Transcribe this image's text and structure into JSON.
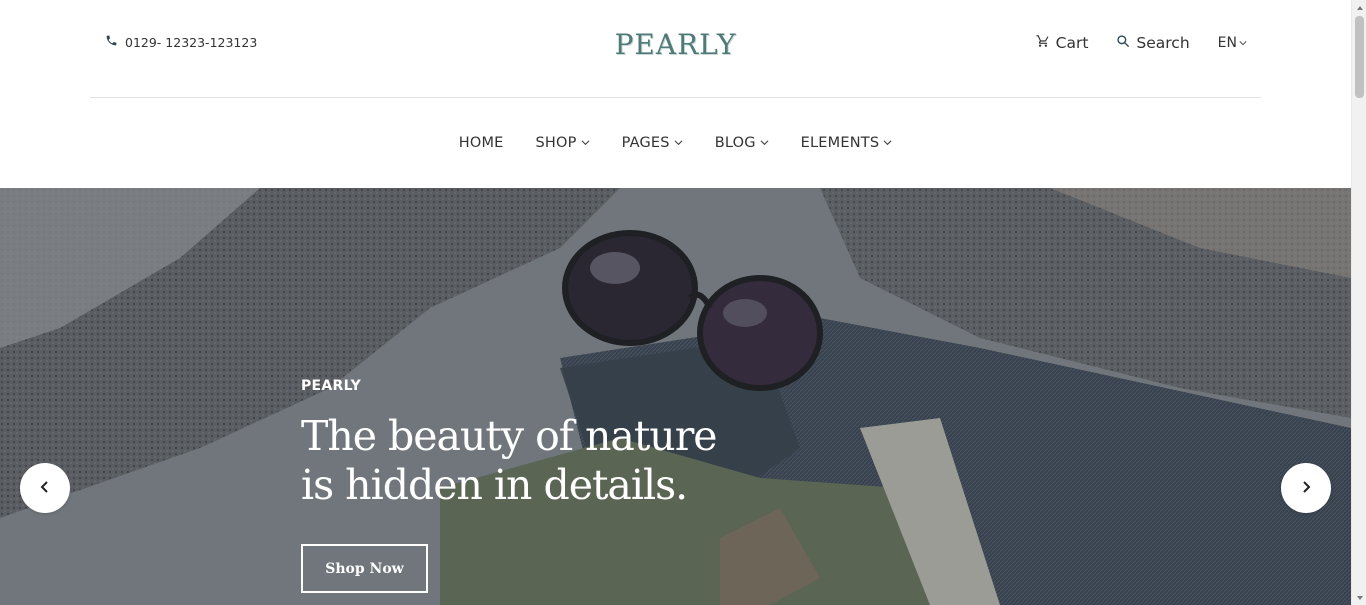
{
  "header": {
    "phone": "0129- 12323-123123",
    "logo": "PEARLY",
    "cart_label": "Cart",
    "search_label": "Search",
    "language": "EN"
  },
  "nav": {
    "items": [
      {
        "label": "HOME"
      },
      {
        "label": "SHOP"
      },
      {
        "label": "PAGES"
      },
      {
        "label": "BLOG"
      },
      {
        "label": "ELEMENTS"
      }
    ]
  },
  "hero": {
    "eyebrow": "PEARLY",
    "headline": "The beauty of nature is hidden in details.",
    "button_label": "Shop Now"
  },
  "icons": {
    "phone": "phone-icon",
    "cart": "cart-icon",
    "search": "search-icon",
    "prev": "chevron-left-icon",
    "next": "chevron-right-icon"
  },
  "colors": {
    "logo": "#4f7a78",
    "text": "#333333",
    "hero_overlay": "#283038"
  }
}
